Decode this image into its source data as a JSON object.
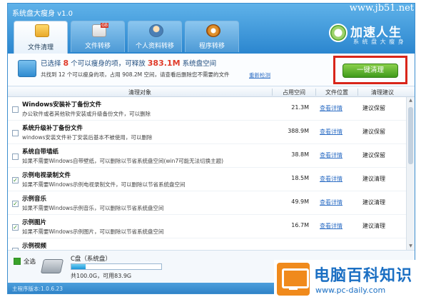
{
  "app": {
    "title": "系统盘大瘦身 v1.0",
    "watermark": "www.jb51.net",
    "version": "主程序版本:1.0.6.23"
  },
  "brand": {
    "name": "加速人生",
    "sub": "系 统 盘 大 瘦 身"
  },
  "tabs": [
    {
      "label": "文件清理",
      "icon": "folder-icon",
      "active": true
    },
    {
      "label": "文件转移",
      "icon": "file-gb-icon",
      "active": false
    },
    {
      "label": "个人资料转移",
      "icon": "user-icon",
      "active": false
    },
    {
      "label": "程序转移",
      "icon": "program-disc-icon",
      "active": false
    }
  ],
  "summary": {
    "prefix": "已选择",
    "count": "8",
    "mid": "个可以瘦身的项，可释放",
    "size": "383.1M",
    "suffix": "系统盘空间",
    "detail": "共找到 12 个可以瘦身的项，占用 908.2M 空间，请查看后删除您不需要的文件",
    "rescan": "重新检测",
    "oneclick": "一键清理"
  },
  "table": {
    "headers": [
      "清理对象",
      "占用空间",
      "文件位置",
      "清理建议"
    ],
    "rows": [
      {
        "title": "Windows安装补丁备份文件",
        "desc": "办公软件或者其他软件安装或升级备份文件，可以删除",
        "size": "21.3M",
        "link": "查看详情",
        "advice": "建议保留",
        "checked": false
      },
      {
        "title": "系统升级补丁备份文件",
        "desc": "windows安装文件补丁安装后基本不被使用，可以删除",
        "size": "388.9M",
        "link": "查看详情",
        "advice": "建议保留",
        "checked": false
      },
      {
        "title": "系统自带墙纸",
        "desc": "如果不需要Windows自带壁纸，可以删除以节省系统盘空间(win7可能无法切换主题)",
        "size": "38.8M",
        "link": "查看详情",
        "advice": "建议保留",
        "checked": false
      },
      {
        "title": "示例电视录制文件",
        "desc": "如果不需要Windows示例电视录制文件，可以删除以节省系统盘空间",
        "size": "18.5M",
        "link": "查看详情",
        "advice": "建议清理",
        "checked": true
      },
      {
        "title": "示例音乐",
        "desc": "如果不需要Windows示例音乐，可以删除以节省系统盘空间",
        "size": "49.9M",
        "link": "查看详情",
        "advice": "建议清理",
        "checked": true
      },
      {
        "title": "示例图片",
        "desc": "如果不需要Windows示例图片，可以删除以节省系统盘空间",
        "size": "16.7M",
        "link": "查看详情",
        "advice": "建议清理",
        "checked": true
      },
      {
        "title": "示例视频",
        "desc": "",
        "size": "",
        "link": "",
        "advice": "",
        "checked": false
      }
    ]
  },
  "footer": {
    "select_all": "全选",
    "disk_name": "C盘（系统盘）",
    "disk_info": "共100.0G，可用83.9G",
    "disk_used_fraction": 0.161
  },
  "site_logo": {
    "name": "电脑百科知识",
    "url": "www.pc-daily.com"
  }
}
